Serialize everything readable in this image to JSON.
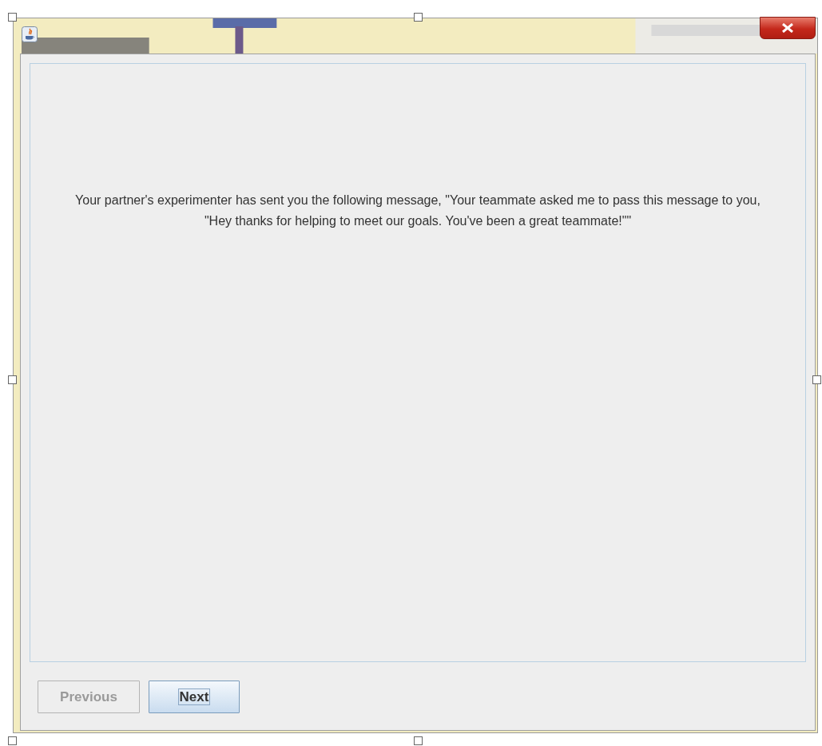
{
  "message": "Your partner's experimenter has sent you the following message, \"Your teammate asked me to pass this message to you, \"Hey thanks for helping to meet our goals. You've been a great teammate!\"\"",
  "buttons": [
    {
      "label": "Previous",
      "disabled": true,
      "focused": false
    },
    {
      "label": "Next",
      "disabled": false,
      "focused": true
    }
  ]
}
